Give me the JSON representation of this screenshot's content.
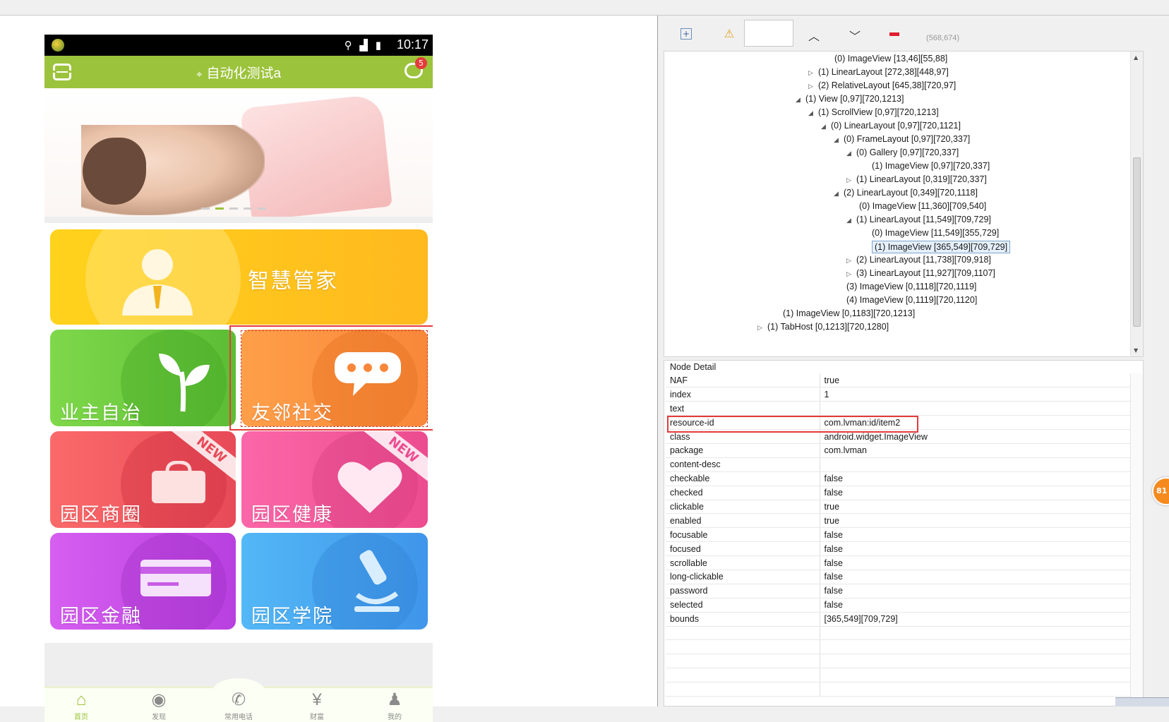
{
  "phone": {
    "status": {
      "time": "10:17",
      "icons": "⚲ ▟ ▮"
    },
    "appbar": {
      "title": "自动化测试a",
      "pin": "⌖",
      "msg_badge": "5"
    },
    "tiles": {
      "butler": "智慧管家",
      "owner": "业主自治",
      "social": "友邻社交",
      "biz": "园区商圈",
      "health": "园区健康",
      "finance": "园区金融",
      "edu": "园区学院",
      "new_badge": "NEW"
    },
    "tabs": [
      {
        "label": "首页",
        "icon": "⌂"
      },
      {
        "label": "发现",
        "icon": "◉"
      },
      {
        "label": "常用电话",
        "icon": "✆"
      },
      {
        "label": "财富",
        "icon": "¥"
      },
      {
        "label": "我的",
        "icon": "♟"
      }
    ]
  },
  "toolbar": {
    "coords": "(568,674)"
  },
  "tree": [
    {
      "text": "(0) ImageView [13,46][55,88]",
      "arrow": ""
    },
    {
      "text": "(1) LinearLayout [272,38][448,97]",
      "arrow": "▷"
    },
    {
      "text": "(2) RelativeLayout [645,38][720,97]",
      "arrow": "▷"
    },
    {
      "text": "(1) View [0,97][720,1213]",
      "arrow": "◢"
    },
    {
      "text": "(1) ScrollView [0,97][720,1213]",
      "arrow": "◢"
    },
    {
      "text": "(0) LinearLayout [0,97][720,1121]",
      "arrow": "◢"
    },
    {
      "text": "(0) FrameLayout [0,97][720,337]",
      "arrow": "◢"
    },
    {
      "text": "(0) Gallery [0,97][720,337]",
      "arrow": "◢"
    },
    {
      "text": "(1) ImageView [0,97][720,337]",
      "arrow": ""
    },
    {
      "text": "(1) LinearLayout [0,319][720,337]",
      "arrow": "▷"
    },
    {
      "text": "(2) LinearLayout [0,349][720,1118]",
      "arrow": "◢"
    },
    {
      "text": "(0) ImageView [11,360][709,540]",
      "arrow": ""
    },
    {
      "text": "(1) LinearLayout [11,549][709,729]",
      "arrow": "◢"
    },
    {
      "text": "(0) ImageView [11,549][355,729]",
      "arrow": ""
    },
    {
      "text": "(1) ImageView [365,549][709,729]",
      "arrow": ""
    },
    {
      "text": "(2) LinearLayout [11,738][709,918]",
      "arrow": "▷"
    },
    {
      "text": "(3) LinearLayout [11,927][709,1107]",
      "arrow": "▷"
    },
    {
      "text": "(3) ImageView [0,1118][720,1119]",
      "arrow": ""
    },
    {
      "text": "(4) ImageView [0,1119][720,1120]",
      "arrow": ""
    },
    {
      "text": "(1) ImageView [0,1183][720,1213]",
      "arrow": ""
    },
    {
      "text": "(1) TabHost [0,1213][720,1280]",
      "arrow": "▷"
    }
  ],
  "detail": {
    "title": "Node Detail",
    "rows": [
      {
        "k": "NAF",
        "v": "true"
      },
      {
        "k": "index",
        "v": "1"
      },
      {
        "k": "text",
        "v": ""
      },
      {
        "k": "resource-id",
        "v": "com.lvman:id/item2"
      },
      {
        "k": "class",
        "v": "android.widget.ImageView"
      },
      {
        "k": "package",
        "v": "com.lvman"
      },
      {
        "k": "content-desc",
        "v": ""
      },
      {
        "k": "checkable",
        "v": "false"
      },
      {
        "k": "checked",
        "v": "false"
      },
      {
        "k": "clickable",
        "v": "true"
      },
      {
        "k": "enabled",
        "v": "true"
      },
      {
        "k": "focusable",
        "v": "false"
      },
      {
        "k": "focused",
        "v": "false"
      },
      {
        "k": "scrollable",
        "v": "false"
      },
      {
        "k": "long-clickable",
        "v": "false"
      },
      {
        "k": "password",
        "v": "false"
      },
      {
        "k": "selected",
        "v": "false"
      },
      {
        "k": "bounds",
        "v": "[365,549][709,729]"
      },
      {
        "k": "",
        "v": ""
      },
      {
        "k": "",
        "v": ""
      },
      {
        "k": "",
        "v": ""
      },
      {
        "k": "",
        "v": ""
      },
      {
        "k": "",
        "v": ""
      }
    ]
  },
  "bubble": "81"
}
